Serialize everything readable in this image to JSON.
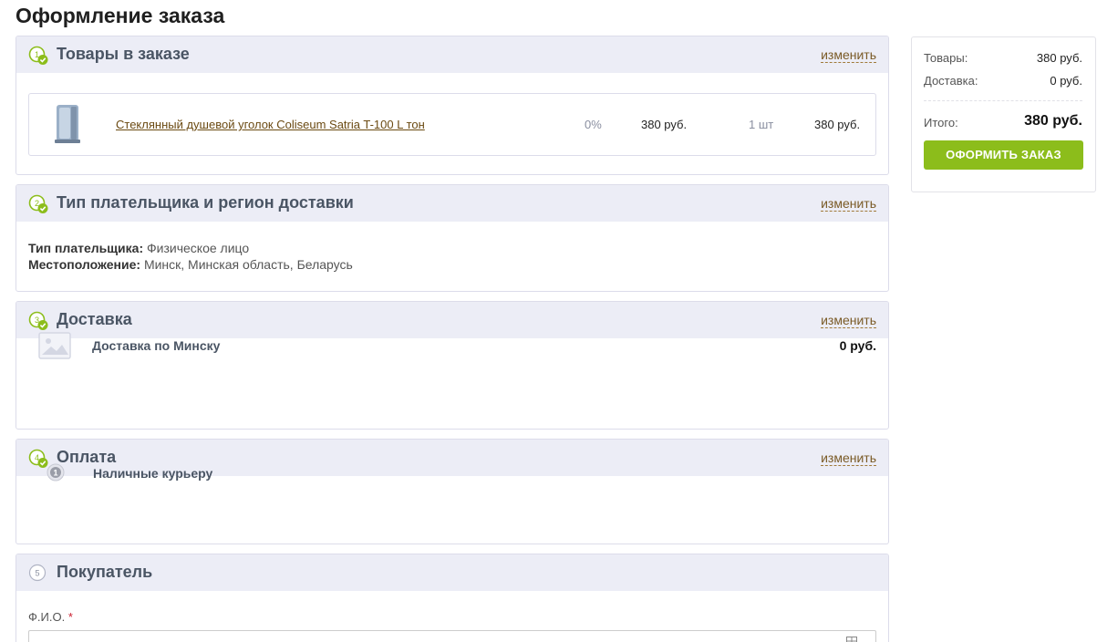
{
  "page": {
    "title": "Оформление заказа"
  },
  "edit_label": "изменить",
  "sections": {
    "items": {
      "step": "1",
      "title": "Товары в заказе",
      "product": {
        "name": "Стеклянный душевой уголок Coliseum Satria T-100 L тон",
        "discount": "0%",
        "price": "380 руб.",
        "quantity": "1 шт",
        "sum": "380 руб."
      }
    },
    "region": {
      "step": "2",
      "title": "Тип плательщика и регион доставки",
      "payer_type_label": "Тип плательщика:",
      "payer_type_value": "Физическое лицо",
      "location_label": "Местоположение:",
      "location_value": "Минск, Минская область, Беларусь"
    },
    "delivery": {
      "step": "3",
      "title": "Доставка",
      "name": "Доставка по Минску",
      "price": "0 руб."
    },
    "payment": {
      "step": "4",
      "title": "Оплата",
      "name": "Наличные курьеру",
      "icon_number": "1"
    },
    "buyer": {
      "step": "5",
      "title": "Покупатель",
      "fio_label": "Ф.И.О.",
      "required_mark": "*",
      "fio_value": ""
    }
  },
  "summary": {
    "goods_label": "Товары:",
    "goods_value": "380 руб.",
    "delivery_label": "Доставка:",
    "delivery_value": "0 руб.",
    "total_label": "Итого:",
    "total_value": "380 руб.",
    "submit_label": "ОФОРМИТЬ ЗАКАЗ"
  },
  "colors": {
    "accent_green": "#8cbd1b",
    "header_bg": "#ecedf6",
    "link_brown": "#7a5a26"
  }
}
